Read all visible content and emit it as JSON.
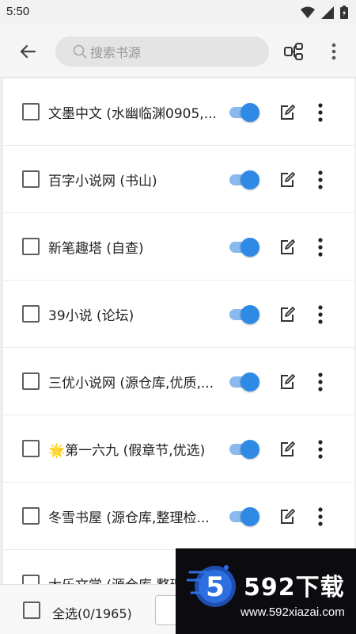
{
  "status_bar": {
    "time": "5:50",
    "icons": [
      "wifi-icon",
      "signal-icon",
      "battery-icon"
    ]
  },
  "toolbar": {
    "back_icon": "arrow-left-icon",
    "search_placeholder": "搜索书源",
    "group_icon": "group-icon",
    "more_icon": "more-vert-icon"
  },
  "sources": [
    {
      "name": "文墨中文 (水幽临渊0905,...",
      "selected": false,
      "enabled": true
    },
    {
      "name": "百字小说网 (书山)",
      "selected": false,
      "enabled": true
    },
    {
      "name": "新笔趣塔 (自查)",
      "selected": false,
      "enabled": true
    },
    {
      "name": "39小说 (论坛)",
      "selected": false,
      "enabled": true
    },
    {
      "name": "三优小说网 (源仓库,优质,...",
      "selected": false,
      "enabled": true
    },
    {
      "name": "🌟第一六九 (假章节,优选)",
      "selected": false,
      "enabled": true
    },
    {
      "name": "冬雪书屋 (源仓库,整理检...",
      "selected": false,
      "enabled": true
    },
    {
      "name": "大乐文学 (源仓库,整理...",
      "selected": false,
      "enabled": true
    }
  ],
  "bottom_bar": {
    "select_all_label": "全选(0/1965)"
  },
  "watermark": {
    "title": "592下载",
    "url": "www.592xiazai.com",
    "logo_text": "5"
  },
  "colors": {
    "accent": "#2f8ae6",
    "track": "#8ab9ee",
    "background": "#eeeeee"
  }
}
